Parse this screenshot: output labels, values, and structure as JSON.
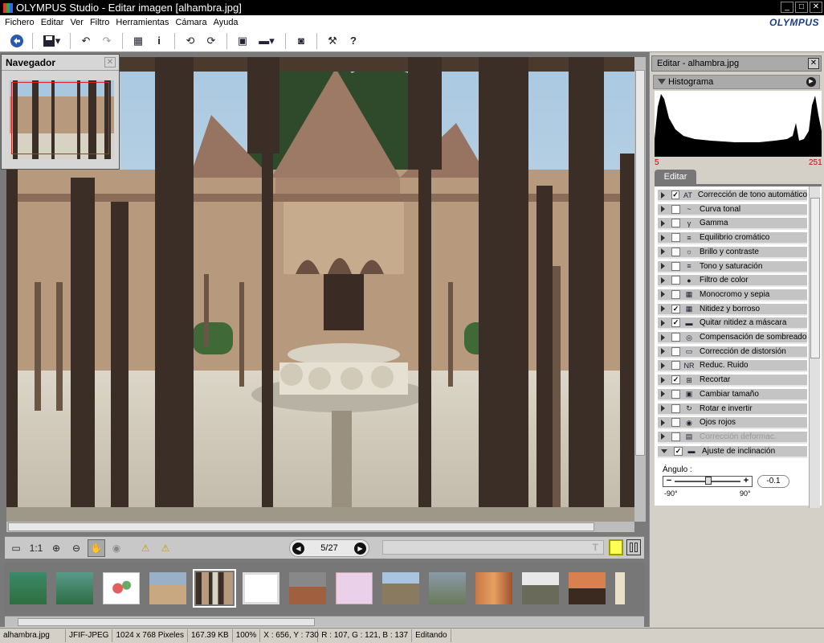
{
  "titlebar": {
    "app": "OLYMPUS Studio",
    "separator": " - ",
    "document": "Editar imagen [alhambra.jpg]"
  },
  "menu": [
    "Fichero",
    "Editar",
    "Ver",
    "Filtro",
    "Herramientas",
    "Cámara",
    "Ayuda"
  ],
  "brand": "OLYMPUS",
  "navigator": {
    "title": "Navegador"
  },
  "viewbar": {
    "one_to_one": "1:1",
    "page": "5/27",
    "caption_icon": "T"
  },
  "status": {
    "file": "alhambra.jpg",
    "format": "JFIF-JPEG",
    "dimensions": "1024 x 768 Pixeles",
    "size": "167.39 KB",
    "zoom": "100%",
    "coords": "X : 656, Y : 730",
    "rgb": "R : 107, G : 121, B : 137",
    "mode": "Editando"
  },
  "panel": {
    "title": "Editar - alhambra.jpg",
    "histogram_label": "Histograma",
    "hist_min": "5",
    "hist_max": "251",
    "edit_tab": "Editar",
    "items": [
      {
        "label": "Corrección de tono automático",
        "checked": true,
        "icon": "AT"
      },
      {
        "label": "Curva tonal",
        "checked": false,
        "icon": "~"
      },
      {
        "label": "Gamma",
        "checked": false,
        "icon": "γ"
      },
      {
        "label": "Equilibrio cromático",
        "checked": false,
        "icon": "≡"
      },
      {
        "label": "Brillo y contraste",
        "checked": false,
        "icon": "☼"
      },
      {
        "label": "Tono y saturación",
        "checked": false,
        "icon": "≡"
      },
      {
        "label": "Filtro de color",
        "checked": false,
        "icon": "●"
      },
      {
        "label": "Monocromo y sepia",
        "checked": false,
        "icon": "▦"
      },
      {
        "label": "Nitidez y borroso",
        "checked": true,
        "icon": "▦"
      },
      {
        "label": "Quitar nitidez a máscara",
        "checked": true,
        "icon": "▬"
      },
      {
        "label": "Compensación de sombreado",
        "checked": false,
        "icon": "◎"
      },
      {
        "label": "Corrección de distorsión",
        "checked": false,
        "icon": "▭"
      },
      {
        "label": "Reduc. Ruido",
        "checked": false,
        "icon": "NR"
      },
      {
        "label": "Recortar",
        "checked": true,
        "icon": "⊞"
      },
      {
        "label": "Cambiar tamaño",
        "checked": false,
        "icon": "▣"
      },
      {
        "label": "Rotar e invertir",
        "checked": false,
        "icon": "↻"
      },
      {
        "label": "Ojos rojos",
        "checked": false,
        "icon": "◉"
      },
      {
        "label": "Corrección deformac.",
        "checked": false,
        "icon": "▤",
        "dim": true
      },
      {
        "label": "Ajuste de inclinación",
        "checked": true,
        "icon": "▬",
        "expanded": true
      }
    ],
    "angle_label": "Ángulo :",
    "angle_value": "-0.1",
    "angle_min": "-90°",
    "angle_max": "90°"
  }
}
